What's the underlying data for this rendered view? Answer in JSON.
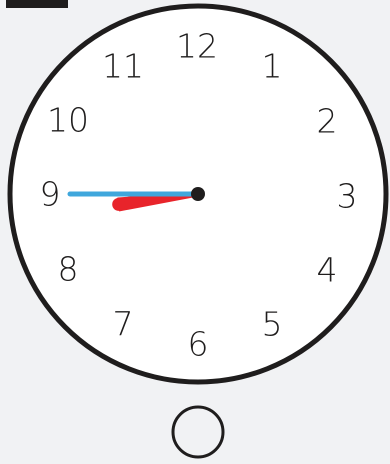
{
  "clock": {
    "numerals": [
      "12",
      "1",
      "2",
      "3",
      "4",
      "5",
      "6",
      "7",
      "8",
      "9",
      "10",
      "11"
    ],
    "time": {
      "hour": 8,
      "minute": 45
    },
    "colors": {
      "face": "#ffffff",
      "rim": "#1f1d1d",
      "numerals": "#1f1d1d",
      "hour_hand": "#e8242b",
      "minute_hand": "#3fa7dc",
      "pivot": "#1f1d1d",
      "background": "#f1f2f4"
    }
  },
  "winder_button": {
    "icon": "circle-outline-icon"
  }
}
